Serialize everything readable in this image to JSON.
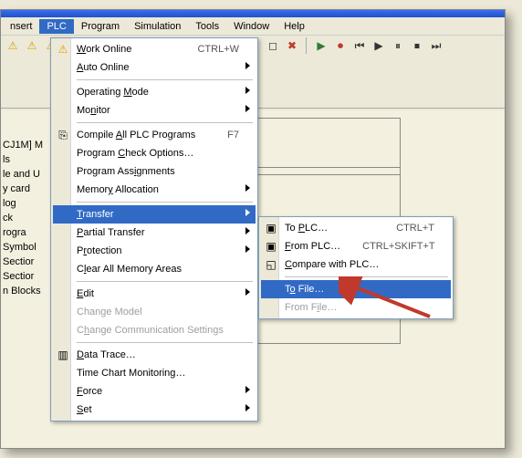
{
  "menubar": {
    "items": [
      {
        "label": "nsert"
      },
      {
        "label": "PLC"
      },
      {
        "label": "Program"
      },
      {
        "label": "Simulation"
      },
      {
        "label": "Tools"
      },
      {
        "label": "Window"
      },
      {
        "label": "Help"
      }
    ],
    "active_index": 1
  },
  "toolbar_icons": [
    {
      "name": "warn-1-icon",
      "glyph": "⚠",
      "cls": "warn"
    },
    {
      "name": "warn-2-icon",
      "glyph": "⚠",
      "cls": "warn"
    },
    {
      "name": "warn-3-icon",
      "glyph": "⚠",
      "cls": "warn"
    },
    {
      "name": "info-icon",
      "glyph": "ⓘ",
      "cls": "info"
    },
    {
      "name": "help-icon",
      "glyph": "?",
      "cls": ""
    },
    {
      "name": "context-help-icon",
      "glyph": "⍰",
      "cls": ""
    },
    {
      "name": "lightning-icon",
      "glyph": "⚡",
      "cls": "warn"
    },
    {
      "name": "lightning-2-icon",
      "glyph": "⚡",
      "cls": "warn"
    },
    {
      "name": "lightning-3-icon",
      "glyph": "⚡",
      "cls": "warn"
    },
    {
      "name": "tool-icon",
      "glyph": "🛠",
      "cls": ""
    },
    {
      "name": "circle-icon",
      "glyph": "◯",
      "cls": ""
    },
    {
      "name": "node-icon",
      "glyph": "⊙",
      "cls": ""
    },
    {
      "name": "square-icon",
      "glyph": "◻",
      "cls": ""
    },
    {
      "name": "delete-icon",
      "glyph": "✖",
      "cls": "red"
    },
    {
      "name": "run-icon",
      "glyph": "▶",
      "cls": "green"
    },
    {
      "name": "record-icon",
      "glyph": "⏺",
      "cls": "red"
    },
    {
      "name": "prev-icon",
      "glyph": "⏮",
      "cls": ""
    },
    {
      "name": "play-icon",
      "glyph": "▶",
      "cls": ""
    },
    {
      "name": "pause-icon",
      "glyph": "⏸",
      "cls": ""
    },
    {
      "name": "stop-icon",
      "glyph": "⏹",
      "cls": ""
    },
    {
      "name": "next-icon",
      "glyph": "⏭",
      "cls": ""
    }
  ],
  "plc_menu": {
    "groups": [
      [
        {
          "label_pre": "",
          "u": "W",
          "label_post": "ork Online",
          "shortcut": "CTRL+W",
          "icon": "⚠",
          "icon_color": "#d9a300",
          "submenu": false,
          "disabled": false,
          "name": "menu-work-online"
        },
        {
          "label_pre": "",
          "u": "A",
          "label_post": "uto Online",
          "submenu": true,
          "disabled": false,
          "name": "menu-auto-online"
        }
      ],
      [
        {
          "label_pre": "Operating ",
          "u": "M",
          "label_post": "ode",
          "submenu": true,
          "disabled": false,
          "name": "menu-operating-mode"
        },
        {
          "label_pre": "Mo",
          "u": "n",
          "label_post": "itor",
          "submenu": true,
          "disabled": false,
          "name": "menu-monitor"
        }
      ],
      [
        {
          "label_pre": "Compile ",
          "u": "A",
          "label_post": "ll PLC Programs",
          "shortcut": "F7",
          "icon": "⎘",
          "submenu": false,
          "disabled": false,
          "name": "menu-compile-all"
        },
        {
          "label_pre": "Program ",
          "u": "C",
          "label_post": "heck Options…",
          "submenu": false,
          "disabled": false,
          "name": "menu-program-check"
        },
        {
          "label_pre": "Program Ass",
          "u": "i",
          "label_post": "gnments",
          "submenu": false,
          "disabled": false,
          "name": "menu-program-assignments"
        },
        {
          "label_pre": "Memor",
          "u": "y",
          "label_post": " Allocation",
          "submenu": true,
          "disabled": false,
          "name": "menu-memory-alloc"
        }
      ],
      [
        {
          "label_pre": "",
          "u": "T",
          "label_post": "ransfer",
          "submenu": true,
          "disabled": false,
          "highlight": true,
          "name": "menu-transfer"
        },
        {
          "label_pre": "",
          "u": "P",
          "label_post": "artial Transfer",
          "submenu": true,
          "disabled": false,
          "name": "menu-partial-transfer"
        },
        {
          "label_pre": "P",
          "u": "r",
          "label_post": "otection",
          "submenu": true,
          "disabled": false,
          "name": "menu-protection"
        },
        {
          "label_pre": "C",
          "u": "l",
          "label_post": "ear All Memory Areas",
          "submenu": false,
          "disabled": false,
          "name": "menu-clear-memory"
        }
      ],
      [
        {
          "label_pre": "",
          "u": "E",
          "label_post": "dit",
          "submenu": true,
          "disabled": false,
          "name": "menu-edit"
        },
        {
          "label_pre": "Chan",
          "u": "g",
          "label_post": "e Model",
          "submenu": false,
          "disabled": true,
          "name": "menu-change-model"
        },
        {
          "label_pre": "C",
          "u": "h",
          "label_post": "ange Communication Settings",
          "submenu": false,
          "disabled": true,
          "name": "menu-change-comm"
        }
      ],
      [
        {
          "label_pre": "",
          "u": "D",
          "label_post": "ata Trace…",
          "icon": "▥",
          "submenu": false,
          "disabled": false,
          "name": "menu-data-trace"
        },
        {
          "label_pre": "Time Chart Monitoring…",
          "u": "",
          "label_post": "",
          "submenu": false,
          "disabled": false,
          "name": "menu-time-chart"
        },
        {
          "label_pre": "",
          "u": "F",
          "label_post": "orce",
          "submenu": true,
          "disabled": false,
          "name": "menu-force"
        },
        {
          "label_pre": "",
          "u": "S",
          "label_post": "et",
          "submenu": true,
          "disabled": false,
          "name": "menu-set"
        }
      ]
    ]
  },
  "transfer_submenu": {
    "groups": [
      [
        {
          "label_pre": "To ",
          "u": "P",
          "label_post": "LC…",
          "shortcut": "CTRL+T",
          "icon": "▣",
          "disabled": false,
          "name": "sub-to-plc"
        },
        {
          "label_pre": "",
          "u": "F",
          "label_post": "rom PLC…",
          "shortcut": "CTRL+SKIFT+T",
          "icon": "▣",
          "disabled": false,
          "name": "sub-from-plc"
        },
        {
          "label_pre": "",
          "u": "C",
          "label_post": "ompare with PLC…",
          "icon": "◱",
          "disabled": false,
          "name": "sub-compare-plc"
        }
      ],
      [
        {
          "label_pre": "T",
          "u": "o",
          "label_post": " File…",
          "disabled": false,
          "highlight": true,
          "name": "sub-to-file"
        },
        {
          "label_pre": "From F",
          "u": "i",
          "label_post": "le…",
          "disabled": true,
          "name": "sub-from-file"
        }
      ]
    ]
  },
  "tree_fragments": [
    "CJ1M] M",
    "ls",
    "le and U",
    "y card",
    "log",
    "ck",
    "rogra",
    "Symbol",
    "Sectior",
    "Sectior",
    "n Blocks"
  ]
}
